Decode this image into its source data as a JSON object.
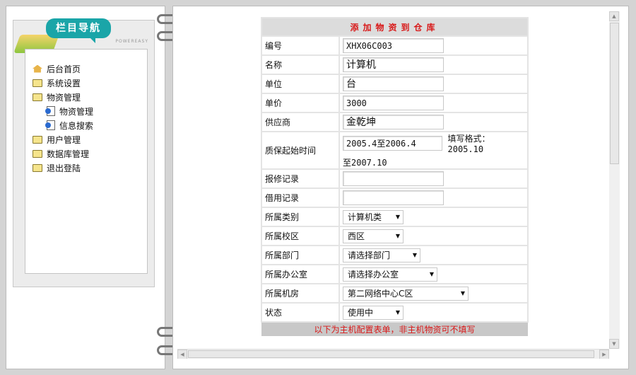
{
  "nav": {
    "title": "栏目导航",
    "brand": "POWEREASY",
    "items": [
      {
        "label": "后台首页",
        "icon": "home-icon"
      },
      {
        "label": "系统设置",
        "icon": "folder-icon"
      },
      {
        "label": "物资管理",
        "icon": "folder-open-icon"
      },
      {
        "label": "物资管理",
        "icon": "page-icon",
        "sub": true
      },
      {
        "label": "信息搜索",
        "icon": "page-icon",
        "sub": true
      },
      {
        "label": "用户管理",
        "icon": "folder-icon"
      },
      {
        "label": "数据库管理",
        "icon": "folder-icon"
      },
      {
        "label": "退出登陆",
        "icon": "folder-icon"
      }
    ]
  },
  "form": {
    "title": "添加物资到仓库",
    "id_label": "编号",
    "id_value": "XHX06C003",
    "name_label": "名称",
    "name_value": "计算机",
    "unit_label": "单位",
    "unit_value": "台",
    "price_label": "单价",
    "price_value": "3000",
    "supplier_label": "供应商",
    "supplier_value": "金乾坤",
    "warranty_label": "质保起始时间",
    "warranty_value": "2005.4至2006.4",
    "warranty_hint": "填写格式：2005.10",
    "warranty_hint2": "至2007.10",
    "repair_label": "报修记录",
    "repair_value": "",
    "borrow_label": "借用记录",
    "borrow_value": "",
    "category_label": "所属类别",
    "category_value": "计算机类",
    "campus_label": "所属校区",
    "campus_value": "西区",
    "dept_label": "所属部门",
    "dept_value": "请选择部门",
    "office_label": "所属办公室",
    "office_value": "请选择办公室",
    "room_label": "所属机房",
    "room_value": "第二网络中心C区",
    "status_label": "状态",
    "status_value": "使用中",
    "footer_note": "以下为主机配置表单，非主机物资可不填写"
  }
}
